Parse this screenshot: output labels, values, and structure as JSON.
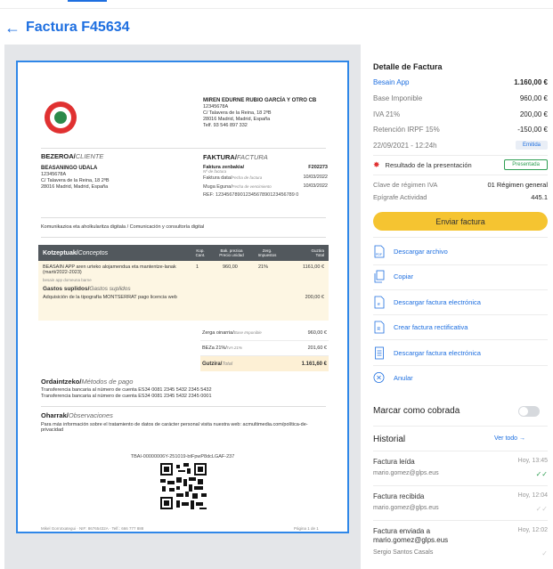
{
  "page": {
    "title": "Factura F45634",
    "back_icon": "arrow-left-icon"
  },
  "document": {
    "company": {
      "name": "MIREN EDURNE RUBIO GARCÍA Y OTRO CB",
      "nif": "12345678A",
      "address1": "C/ Talavera de la Reina, 18 2ºB",
      "address2": "28016 Madrid, Madrid, España",
      "phone": "Telf. 93 546 897 332"
    },
    "client": {
      "heading": "BEZEROA/",
      "heading_es": "CLIENTE",
      "name": "BEASANINGO UDALA",
      "nif": "12345678A",
      "address1": "C/ Talavera de la Reina, 18 2ºB",
      "address2": "28016 Madrid, Madrid, España"
    },
    "invoice": {
      "heading": "FAKTURA/",
      "heading_es": "FACTURA",
      "number_label": "Faktura zenbakia/",
      "number_label_es": "Nº de factura",
      "number": "F202273",
      "date_label": "Faktura data/",
      "date_label_es": "Fecha de factura",
      "date": "10/03/2022",
      "due_label": "Muga Eguna/",
      "due_label_es": "Fecha de vencimiento",
      "due": "10/03/2022",
      "ref": "REF: 12345678901234567890123456789 0"
    },
    "activity": "Komunikazioa eta aholkularitza digitala / Comunicación y consultoría digital",
    "concepts": {
      "heading": "Kotzeptuak/",
      "heading_es": "Conceptos",
      "col_qty": "Kop.",
      "col_qty_es": "Cant.",
      "col_price": "Bak. prezioa",
      "col_price_es": "Precio unidad",
      "col_tax": "Zerg.",
      "col_tax_es": "Impuestos",
      "col_total": "Guztira",
      "col_total_es": "Total",
      "item_desc": "BEASAIN APP aren urteko alojamendua eta mantentze-lanak (marti/2022-2023)",
      "item_qty": "1",
      "item_price": "960,00",
      "item_tax": "21%",
      "item_total": "1161,00 €",
      "item_note": "besain app domeuna barne",
      "supl_heading": "Gastos suplidos/",
      "supl_heading_es": "Gastos suplidos",
      "supl_desc": "Adquisición de la tipografía MONTSERRAT pago licencia web",
      "supl_total": "200,00 €"
    },
    "totals": {
      "base_label": "Zerga oinarria/",
      "base_label_es": "Base Imponible",
      "base": "960,00 €",
      "vat_label": "BEZa 21%/",
      "vat_label_es": "IVA 21%",
      "vat": "201,60 €",
      "total_label": "Gutzira/",
      "total_label_es": "Total",
      "total": "1.161,60 €"
    },
    "payment": {
      "heading": "Ordaintzeko/",
      "heading_es": "Métodos de pago",
      "line1": "Transferencia bancaria al número de cuenta ES34 0081 2345 5432 2345 5432",
      "line2": "Transferencia bancaria al número de cuenta ES34 0081 2345 5432 2345 0001"
    },
    "observations": {
      "heading": "Oharrak/",
      "heading_es": "Observaciones",
      "text": "Para más información sobre el tratamiento de datos de carácter personal visita nuestra web: acmultimedia.com/política-de-privacidad"
    },
    "tbai": "TBAI-00000006Y-251019-btFpwP8dcLGAF-237",
    "footer_left": "Mikel Gorrotxategui · NIF: 86765432A · Telf.: 666 777 888",
    "footer_right": "Página 1 de 1"
  },
  "detail": {
    "title": "Detalle de Factura",
    "app_label": "Besain App",
    "app_value": "1.160,00 €",
    "base_label": "Base Imponible",
    "base_value": "960,00 €",
    "vat_label": "IVA 21%",
    "vat_value": "200,00 €",
    "irpf_label": "Retención IRPF 15%",
    "irpf_value": "-150,00 €",
    "datetime": "22/09/2021 - 12:24h",
    "status": "Emitida",
    "presentation_label": "Resultado de la presentación",
    "presentation_status": "Presentada",
    "regime_label": "Clave de régimen IVA",
    "regime_value": "01 Régimen general",
    "epigraph_label": "Epígrafe Actividad",
    "epigraph_value": "445.1",
    "send_button": "Enviar factura",
    "colors": {
      "accent": "#1e6fe0",
      "send": "#f5c431",
      "success": "#2e9e52",
      "danger": "#e03131"
    }
  },
  "actions": [
    {
      "label": "Descargar archivo",
      "icon": "pdf-file-icon"
    },
    {
      "label": "Copiar",
      "icon": "copy-icon"
    },
    {
      "label": "Descargar factura electrónica",
      "icon": "e-invoice-file-icon"
    },
    {
      "label": "Crear factura rectificativa",
      "icon": "rectify-file-icon"
    },
    {
      "label": "Descargar factura electrónica",
      "icon": "document-icon"
    },
    {
      "label": "Anular",
      "icon": "cancel-circle-icon"
    }
  ],
  "paid_toggle": {
    "label": "Marcar como cobrada",
    "on": false
  },
  "history": {
    "title": "Historial",
    "see_all": "Ver todo →",
    "items": [
      {
        "event": "Factura leída",
        "time": "Hoy, 13:45",
        "user": "mario.gomez@glps.eus",
        "check": "✓✓"
      },
      {
        "event": "Factura recibida",
        "time": "Hoy, 12:04",
        "user": "mario.gomez@glps.eus",
        "check": "✓✓"
      },
      {
        "event": "Factura enviada a mario.gomez@glps.eus",
        "time": "Hoy, 12:02",
        "user": "Sergio Santos Casals",
        "check": "✓"
      }
    ]
  }
}
